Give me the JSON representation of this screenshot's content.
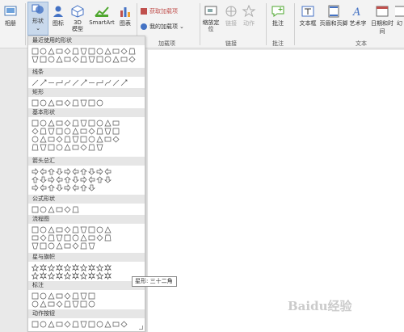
{
  "ribbon": {
    "album": "相册",
    "shapes": "形状",
    "icons": "图标",
    "model3d": "3D 模型",
    "smartart": "SmartArt",
    "chart": "图表",
    "get_addins": "获取加载项",
    "my_addins": "我的加载项",
    "addins_group": "加载项",
    "zoom": "缩放定位",
    "link": "链接",
    "action": "动作",
    "links_group": "链接",
    "comment": "批注",
    "comment_group": "批注",
    "textbox": "文本框",
    "header_footer": "页眉和页脚",
    "wordart": "艺术字",
    "datetime": "日期和时间",
    "slide_number": "幻",
    "text_group": "文本",
    "accent": "#c0504d"
  },
  "gallery": {
    "sections": [
      {
        "title": "最近使用的形状"
      },
      {
        "title": "线条"
      },
      {
        "title": "矩形"
      },
      {
        "title": "基本形状"
      },
      {
        "title": "箭头总汇"
      },
      {
        "title": "公式形状"
      },
      {
        "title": "流程图"
      },
      {
        "title": "星与旗帜"
      },
      {
        "title": "标注"
      },
      {
        "title": "动作按钮"
      }
    ]
  },
  "tooltip": "星形: 三十二角",
  "watermark": "Baidu经验"
}
